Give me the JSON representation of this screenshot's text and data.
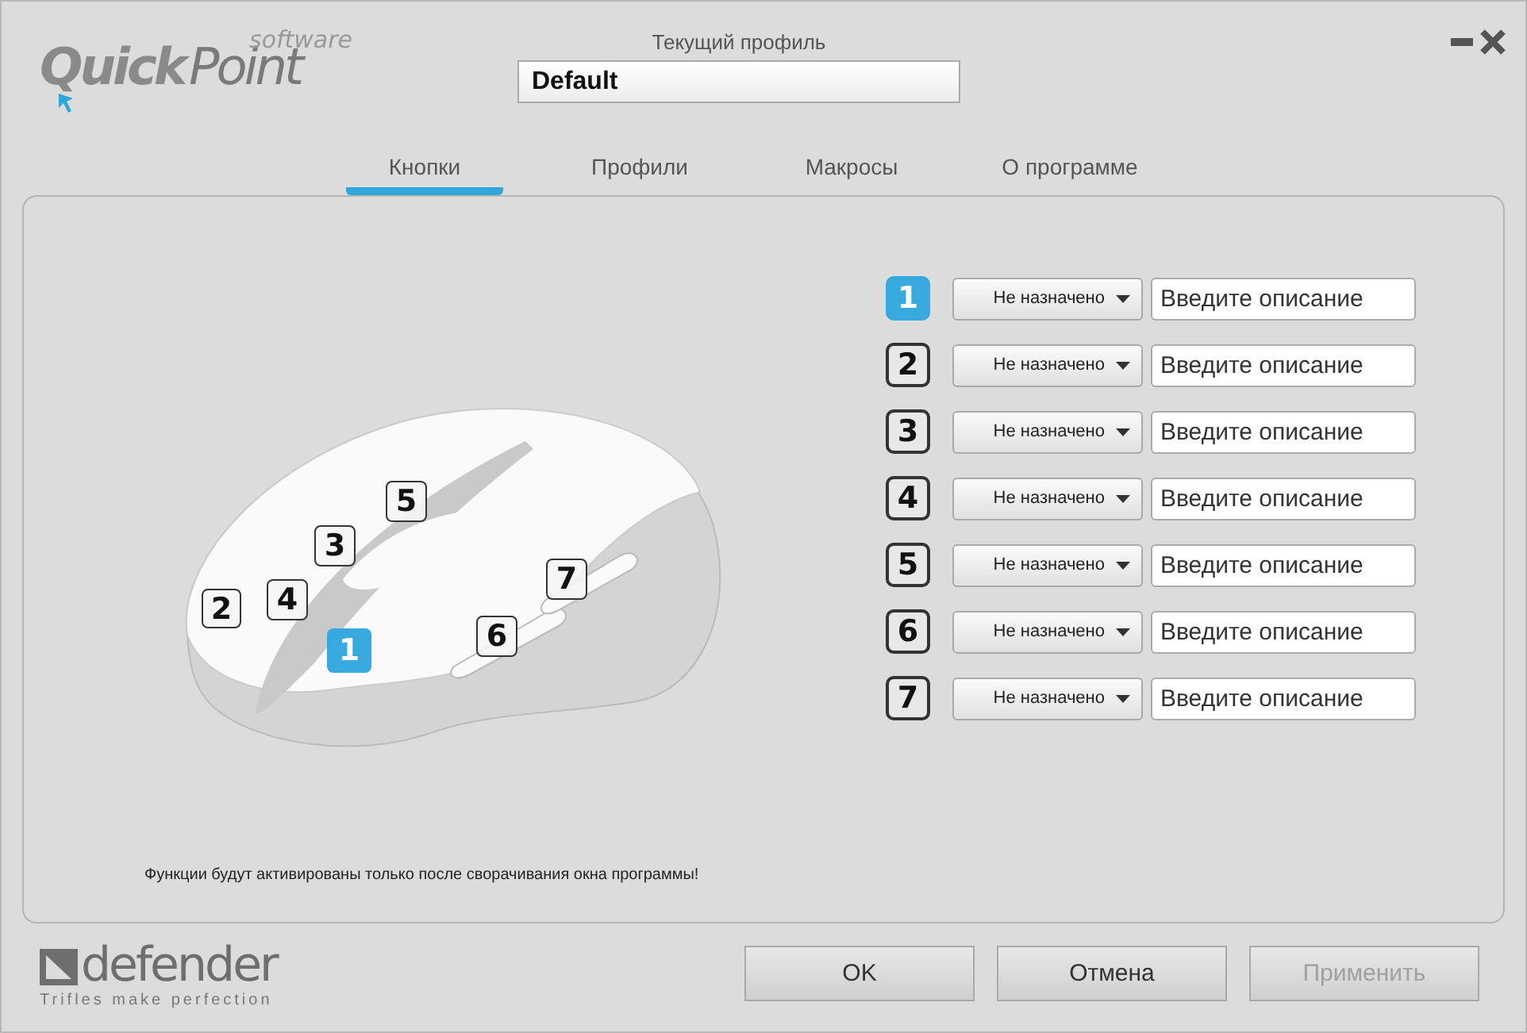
{
  "logo": {
    "word_1": "Quick",
    "word_2": "Point",
    "tagline": "software"
  },
  "window_controls": [
    {
      "kind": "minimize"
    },
    {
      "kind": "close"
    }
  ],
  "profile": {
    "label": "Текущий профиль",
    "value": "Default"
  },
  "tabs": [
    {
      "label": "Кнопки",
      "selected": true
    },
    {
      "label": "Профили",
      "selected": false
    },
    {
      "label": "Макросы",
      "selected": false
    },
    {
      "label": "О программе",
      "selected": false
    }
  ],
  "mouse_buttons": [
    {
      "number": "1",
      "selected": true
    },
    {
      "number": "2",
      "selected": false
    },
    {
      "number": "3",
      "selected": false
    },
    {
      "number": "4",
      "selected": false
    },
    {
      "number": "5",
      "selected": false
    },
    {
      "number": "6",
      "selected": false
    },
    {
      "number": "7",
      "selected": false
    }
  ],
  "assignments": [
    {
      "number": "1",
      "selected": true,
      "action": "Не назначено",
      "placeholder": "Введите описание"
    },
    {
      "number": "2",
      "selected": false,
      "action": "Не назначено",
      "placeholder": "Введите описание"
    },
    {
      "number": "3",
      "selected": false,
      "action": "Не назначено",
      "placeholder": "Введите описание"
    },
    {
      "number": "4",
      "selected": false,
      "action": "Не назначено",
      "placeholder": "Введите описание"
    },
    {
      "number": "5",
      "selected": false,
      "action": "Не назначено",
      "placeholder": "Введите описание"
    },
    {
      "number": "6",
      "selected": false,
      "action": "Не назначено",
      "placeholder": "Введите описание"
    },
    {
      "number": "7",
      "selected": false,
      "action": "Не назначено",
      "placeholder": "Введите описание"
    }
  ],
  "note": "Функции будут активированы только после сворачивания окна программы!",
  "brand": {
    "name": "defender",
    "slogan": "Trifles make perfection"
  },
  "buttons": [
    {
      "label": "OK",
      "disabled": false
    },
    {
      "label": "Отмена",
      "disabled": false
    },
    {
      "label": "Применить",
      "disabled": true
    }
  ]
}
